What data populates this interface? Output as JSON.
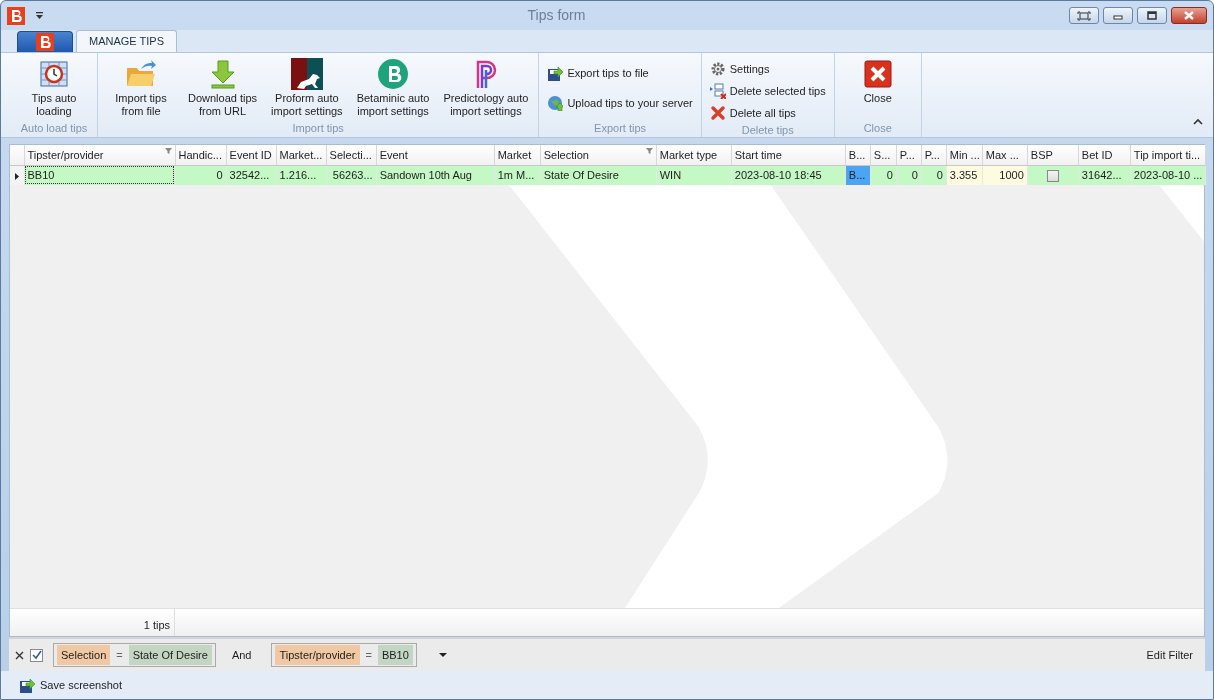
{
  "window": {
    "title": "Tips form"
  },
  "tabs": [
    {
      "label": "MANAGE TIPS",
      "selected": true
    }
  ],
  "ribbon": {
    "groups": [
      {
        "caption": "Auto load tips",
        "kind": "large",
        "buttons": [
          {
            "label": "Tips auto\nloading"
          }
        ]
      },
      {
        "caption": "Import tips",
        "kind": "large",
        "buttons": [
          {
            "label": "Import tips\nfrom file"
          },
          {
            "label": "Download tips\nfrom URL"
          },
          {
            "label": "Proform auto\nimport settings"
          },
          {
            "label": "Betaminic auto\nimport settings"
          },
          {
            "label": "Predictology auto\nimport settings"
          }
        ]
      },
      {
        "caption": "Export tips",
        "kind": "small",
        "buttons": [
          {
            "label": "Export tips to file"
          },
          {
            "label": "Upload tips to your server"
          }
        ]
      },
      {
        "caption": "Delete tips",
        "kind": "small",
        "buttons": [
          {
            "label": "Settings"
          },
          {
            "label": "Delete selected tips"
          },
          {
            "label": "Delete all tips"
          }
        ]
      },
      {
        "caption": "Close",
        "kind": "large",
        "buttons": [
          {
            "label": "Close"
          }
        ]
      }
    ]
  },
  "grid": {
    "columns": [
      {
        "title": "Tipster/provider",
        "filtered": true
      },
      {
        "title": "Handic...",
        "filtered": false
      },
      {
        "title": "Event ID",
        "filtered": false
      },
      {
        "title": "Market...",
        "filtered": false
      },
      {
        "title": "Selecti...",
        "filtered": false
      },
      {
        "title": "Event",
        "filtered": false
      },
      {
        "title": "Market",
        "filtered": false
      },
      {
        "title": "Selection",
        "filtered": true
      },
      {
        "title": "Market type",
        "filtered": false
      },
      {
        "title": "Start time",
        "filtered": false
      },
      {
        "title": "B...",
        "filtered": false
      },
      {
        "title": "S...",
        "filtered": false
      },
      {
        "title": "P...",
        "filtered": false
      },
      {
        "title": "P...",
        "filtered": false
      },
      {
        "title": "Min ...",
        "filtered": false
      },
      {
        "title": "Max ...",
        "filtered": false
      },
      {
        "title": "BSP",
        "filtered": false
      },
      {
        "title": "Bet ID",
        "filtered": false
      },
      {
        "title": "Tip import ti...",
        "filtered": false
      }
    ],
    "rows": [
      {
        "current": true,
        "color": "#c4f8c4",
        "cells": [
          {
            "kind": "text",
            "text": "BB10",
            "focused": true
          },
          {
            "kind": "number",
            "text": "0",
            "focused": false
          },
          {
            "kind": "text",
            "text": "32542...",
            "focused": false
          },
          {
            "kind": "text",
            "text": "1.216...",
            "focused": false
          },
          {
            "kind": "number",
            "text": "56263...",
            "focused": false
          },
          {
            "kind": "text",
            "text": "Sandown 10th Aug",
            "focused": false
          },
          {
            "kind": "text",
            "text": "1m M...",
            "focused": false
          },
          {
            "kind": "text",
            "text": "State Of Desire",
            "focused": false
          },
          {
            "kind": "text",
            "text": "WIN",
            "focused": false
          },
          {
            "kind": "text",
            "text": "2023-08-10 18:45",
            "focused": false
          },
          {
            "kind": "text",
            "text": "B...",
            "focused": false,
            "color": "#4ca4f4"
          },
          {
            "kind": "number",
            "text": "0",
            "focused": false
          },
          {
            "kind": "number",
            "text": "0",
            "focused": false
          },
          {
            "kind": "number",
            "text": "0",
            "focused": false
          },
          {
            "kind": "text",
            "text": "3.355",
            "focused": false,
            "color": "#fffbe0"
          },
          {
            "kind": "number",
            "text": "1000",
            "focused": false,
            "color": "#fffbe0"
          },
          {
            "kind": "check",
            "checked": false,
            "focused": false
          },
          {
            "kind": "text",
            "text": "31642...",
            "focused": false
          },
          {
            "kind": "text",
            "text": "2023-08-10 ...",
            "focused": false
          }
        ]
      }
    ],
    "summary": "1 tips"
  },
  "filter": {
    "enabled": true,
    "conditions": [
      {
        "field": "Selection",
        "operator": "=",
        "value": "State Of Desire"
      },
      {
        "field": "Tipster/provider",
        "operator": "=",
        "value": "BB10"
      }
    ],
    "conjunction": "And",
    "edit_label": "Edit Filter"
  },
  "status_bar": {
    "action": "Save screenshot"
  }
}
